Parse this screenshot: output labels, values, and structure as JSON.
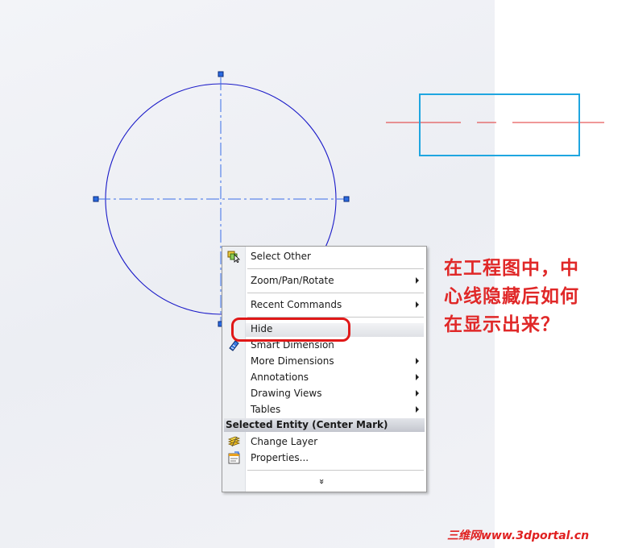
{
  "menu": {
    "items": [
      {
        "label": "Select Other",
        "icon": "select-other-icon",
        "submenu": false
      },
      {
        "label": "Zoom/Pan/Rotate",
        "submenu": true
      },
      {
        "label": "Recent Commands",
        "submenu": true
      },
      {
        "label": "Hide",
        "submenu": false
      },
      {
        "label": "Smart Dimension",
        "icon": "smart-dimension-icon",
        "submenu": false
      },
      {
        "label": "More Dimensions",
        "submenu": true
      },
      {
        "label": "Annotations",
        "submenu": true
      },
      {
        "label": "Drawing Views",
        "submenu": true
      },
      {
        "label": "Tables",
        "submenu": true
      },
      {
        "label": "Change Layer",
        "icon": "change-layer-icon",
        "submenu": false
      },
      {
        "label": "Properties...",
        "icon": "properties-icon",
        "submenu": false
      }
    ],
    "section_header": "Selected Entity (Center Mark)",
    "more_glyph": "»"
  },
  "annotation": {
    "lines": [
      "在工程图中，中",
      "心线隐藏后如何",
      "在显示出来？"
    ]
  },
  "watermark": "三维网www.3dportal.cn",
  "colors": {
    "circle": "#1a1ac8",
    "centerline": "#3a6ee8",
    "box": "#1fa6e0",
    "red_marker": "#e01818",
    "note_text": "#e02828"
  }
}
